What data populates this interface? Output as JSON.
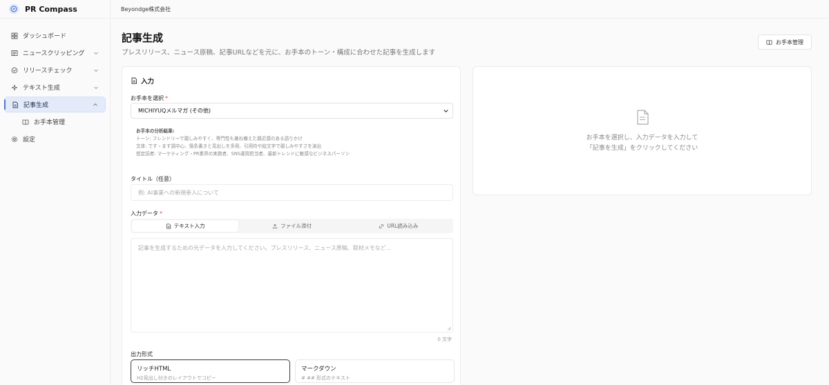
{
  "brand": {
    "name": "PR Compass"
  },
  "company": "Beyondge株式会社",
  "sidebar": {
    "items": [
      {
        "label": "ダッシュボード",
        "icon": "grid-icon"
      },
      {
        "label": "ニュースクリッピング",
        "icon": "newspaper-icon"
      },
      {
        "label": "リリースチェック",
        "icon": "check-circle-icon"
      },
      {
        "label": "テキスト生成",
        "icon": "sparkle-icon"
      },
      {
        "label": "記事生成",
        "icon": "document-icon"
      },
      {
        "label": "お手本管理",
        "icon": "book-icon"
      },
      {
        "label": "設定",
        "icon": "gear-icon"
      }
    ]
  },
  "header": {
    "title": "記事生成",
    "subtitle": "プレスリリース、ニュース原稿、記事URLなどを元に、お手本のトーン・構成に合わせた記事を生成します",
    "manage_button": "お手本管理"
  },
  "input_card": {
    "title": "入力",
    "template_label": "お手本を選択",
    "required_mark": "*",
    "template_value": "MICHIYUQメルマガ (その他)",
    "analysis": {
      "heading": "お手本の分析結果:",
      "lines": [
        "トーン: フレンドリーで親しみやすく、専門性も兼ね備えた親近感のある語りかけ",
        "文体: です・ます調中心、箇条書きと見出しを多用、引用符や絵文字で親しみやすさを演出",
        "想定読者: マーケティング・PR業界の実務者、SNS運用担当者、最新トレンドに敏感なビジネスパーソン"
      ]
    },
    "title_label": "タイトル（任意）",
    "title_placeholder": "例: AI事業への新規参入について",
    "data_label": "入力データ",
    "tabs": [
      {
        "label": "テキスト入力",
        "icon": "document-icon"
      },
      {
        "label": "ファイル添付",
        "icon": "upload-icon"
      },
      {
        "label": "URL読み込み",
        "icon": "link-icon"
      }
    ],
    "data_placeholder": "記事を生成するための元データを入力してください。プレスリリース、ニュース原稿、取材メモなど...",
    "char_count": "0 文字",
    "format_label": "出力形式",
    "formats": [
      {
        "title": "リッチHTML",
        "desc": "H2見出し付きのレイアウトでコピー"
      },
      {
        "title": "マークダウン",
        "desc": "# ## 形式のテキスト"
      }
    ]
  },
  "result_card": {
    "line1": "お手本を選択し、入力データを入力して",
    "line2": "「記事を生成」をクリックしてください"
  },
  "colors": {
    "accent": "#4a76d8",
    "active_bg": "#e3ebfb",
    "required": "#e0483f"
  }
}
